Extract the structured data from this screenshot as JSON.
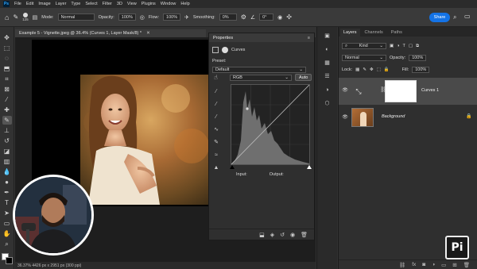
{
  "menubar": {
    "logo": "Ps",
    "items": [
      "File",
      "Edit",
      "Image",
      "Layer",
      "Type",
      "Select",
      "Filter",
      "3D",
      "View",
      "Plugins",
      "Window",
      "Help"
    ]
  },
  "options": {
    "brush_size": "125",
    "mode_label": "Mode:",
    "mode_value": "Normal",
    "opacity_label": "Opacity:",
    "opacity_value": "100%",
    "flow_label": "Flow:",
    "flow_value": "100%",
    "smoothing_label": "Smoothing:",
    "smoothing_value": "0%",
    "angle_value": "0°",
    "share_label": "Share"
  },
  "document": {
    "tab_title": "Example 5 - Vignette.jpeg @ 36.4% (Curves 1, Layer Mask/8) *",
    "status": "36.37%   4426 px x 2951 px (300 ppi)"
  },
  "properties": {
    "title": "Properties",
    "adjustment_name": "Curves",
    "preset_label": "Preset:",
    "preset_value": "Default",
    "channel_value": "RGB",
    "auto_label": "Auto",
    "input_label": "Input:",
    "output_label": "Output:"
  },
  "layers": {
    "tabs": [
      "Layers",
      "Channels",
      "Paths"
    ],
    "filter_value": "Kind",
    "blend_value": "Normal",
    "opacity_label": "Opacity:",
    "opacity_value": "100%",
    "lock_label": "Lock:",
    "fill_label": "Fill:",
    "fill_value": "100%",
    "items": [
      {
        "name": "Curves 1"
      },
      {
        "name": "Background"
      }
    ]
  },
  "brand": {
    "mark": "Pi"
  },
  "colors": {
    "accent": "#1473e6",
    "panel": "#2f2f2f",
    "selected_layer": "#4a4a4a"
  }
}
